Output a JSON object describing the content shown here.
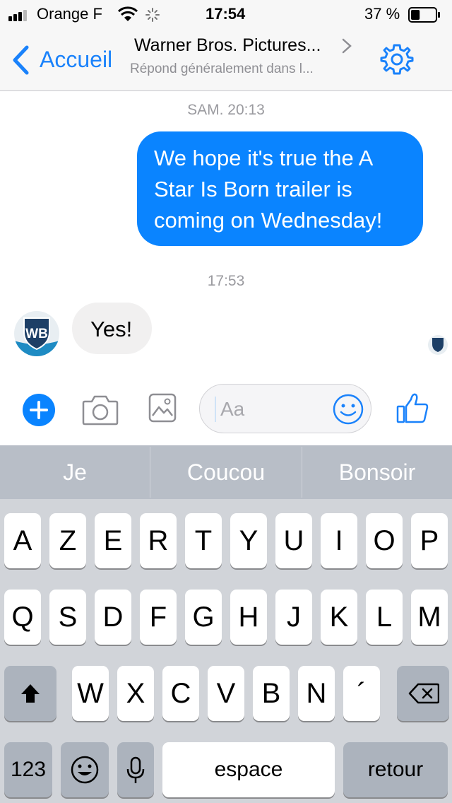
{
  "status_bar": {
    "carrier": "Orange F",
    "time": "17:54",
    "battery": "37 %",
    "battery_level": 0.37
  },
  "nav": {
    "back_label": "Accueil",
    "title": "Warner Bros. Pictures...",
    "subtitle": "Répond généralement dans l..."
  },
  "chat": {
    "timestamp_1": "SAM. 20:13",
    "outgoing_message": "We hope it's true the A Star Is Born trailer is coming on Wednesday!",
    "timestamp_2": "17:53",
    "incoming_message": "Yes!",
    "sender_logo_text": "WB"
  },
  "composer": {
    "placeholder": "Aa"
  },
  "colors": {
    "accent": "#0a84ff",
    "bubble_in": "#f1f0f0",
    "keyboard_bg": "#d1d4d9"
  },
  "keyboard": {
    "suggestions": [
      "Je",
      "Coucou",
      "Bonsoir"
    ],
    "row1": [
      "A",
      "Z",
      "E",
      "R",
      "T",
      "Y",
      "U",
      "I",
      "O",
      "P"
    ],
    "row2": [
      "Q",
      "S",
      "D",
      "F",
      "G",
      "H",
      "J",
      "K",
      "L",
      "M"
    ],
    "row3": [
      "W",
      "X",
      "C",
      "V",
      "B",
      "N",
      "´"
    ],
    "numbers_label": "123",
    "space_label": "espace",
    "return_label": "retour"
  }
}
